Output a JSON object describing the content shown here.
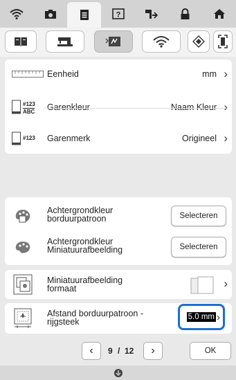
{
  "top_tabs": [
    "wifi-icon",
    "camera-icon",
    "document-icon",
    "help-icon",
    "machine-icon",
    "lock-icon",
    "home-icon"
  ],
  "sub_tabs": [
    "book-icon",
    "sewing-machine-icon",
    "embroidery-icon",
    "wifi-icon",
    "diamond-icon",
    "frame-icon"
  ],
  "settings": {
    "unit": {
      "label": "Eenheid",
      "value": "mm"
    },
    "thread_color": {
      "label": "Garenkleur",
      "value": "Naam Kleur",
      "icon_text_top": "#123",
      "icon_text_bottom": "ABC"
    },
    "thread_brand": {
      "label": "Garenmerk",
      "value": "Origineel",
      "icon_text": "#123"
    }
  },
  "background": {
    "embroidery_bg": {
      "label_line1": "Achtergrondkleur",
      "label_line2": "borduurpatroon",
      "button": "Selecteren"
    },
    "thumb_bg": {
      "label_line1": "Achtergrondkleur",
      "label_line2": "Miniatuurafbeelding",
      "button": "Selecteren"
    }
  },
  "thumbnail_size": {
    "label_line1": "Miniatuurafbeelding",
    "label_line2": "formaat"
  },
  "distance": {
    "label_line1": "Afstand borduurpatroon -",
    "label_line2": "rijgsteek",
    "value": "5.0 mm"
  },
  "pager": {
    "current": "9",
    "separator": "/",
    "total": "12",
    "ok": "OK"
  },
  "colors": {
    "highlight": "#1a6fd0",
    "accent_bg": "#e9e9e9"
  }
}
